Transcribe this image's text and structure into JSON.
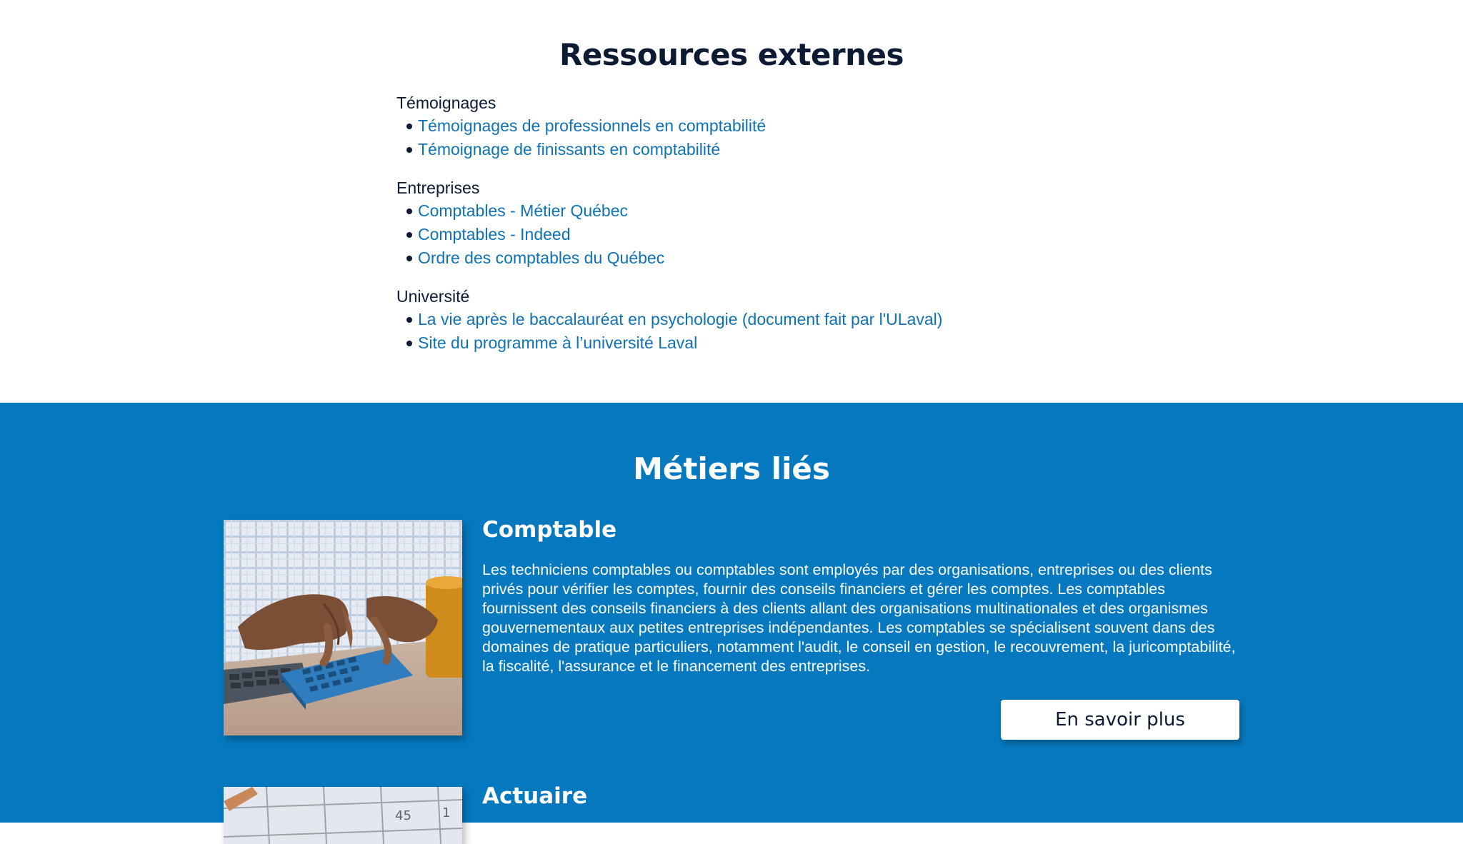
{
  "resources": {
    "title": "Ressources externes",
    "groups": [
      {
        "title": "Témoignages",
        "links": [
          "Témoignages de professionnels en comptabilité",
          "Témoignage de finissants en comptabilité"
        ]
      },
      {
        "title": "Entreprises",
        "links": [
          "Comptables - Métier Québec",
          "Comptables - Indeed",
          "Ordre des comptables du Québec"
        ]
      },
      {
        "title": "Université",
        "links": [
          "La vie après le baccalauréat en psychologie (document fait par l'ULaval)",
          "Site du programme à l’université Laval"
        ]
      }
    ]
  },
  "jobs": {
    "title": "Métiers liés",
    "items": [
      {
        "title": "Comptable",
        "image": "calculator-photo",
        "description": "Les techniciens comptables ou comptables  sont employés par des organisations, entreprises ou des clients privés pour vérifier les comptes, fournir des conseils financiers et gérer les comptes. Les comptables fournissent des conseils financiers à des clients allant des organisations multinationales et des organismes gouvernementaux aux petites entreprises indépendantes. Les comptables se spécialisent souvent dans des domaines de pratique particuliers, notamment l'audit, le conseil en gestion, le recouvrement, la juricomptabilité, la fiscalité, l'assurance et le financement des entreprises.",
        "button": "En savoir plus"
      },
      {
        "title": "Actuaire",
        "image": "calendar-photo"
      }
    ]
  },
  "colors": {
    "section_blue": "#0579bf",
    "link_blue": "#0e72b5",
    "heading_dark": "#0c1a33",
    "white": "#ffffff"
  }
}
